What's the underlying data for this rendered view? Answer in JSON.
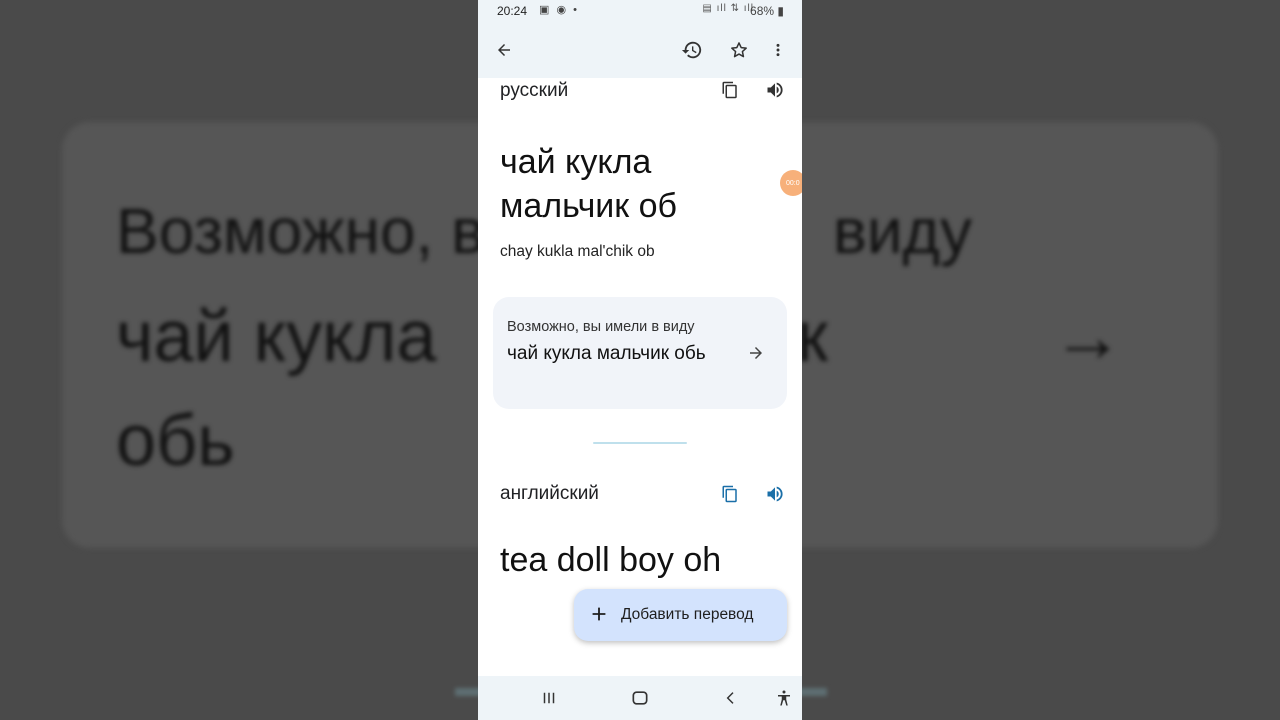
{
  "background": {
    "line1": "Возможно, в",
    "line1_right": "виду",
    "line2": "чай кукла",
    "line2_right": "к",
    "line3": "обь",
    "arrow": "→"
  },
  "status_bar": {
    "time": "20:24",
    "battery": "68%"
  },
  "top_bar": {
    "icons": [
      "back-arrow-icon",
      "history-icon",
      "star-icon",
      "more-vert-icon"
    ]
  },
  "source": {
    "language": "русский",
    "text": "чай кукла мальчик об",
    "transliteration": "chay kukla mal'chik ob"
  },
  "suggestion": {
    "label": "Возможно, вы имели в виду",
    "text": "чай кукла мальчик обь"
  },
  "target": {
    "language": "английский",
    "text": "tea doll boy oh"
  },
  "fab": {
    "label": "Добавить перевод"
  },
  "colors": {
    "accent": "#1a73e8",
    "card_bg": "#f1f4f9",
    "fab_bg": "#d3e3fd",
    "bar_bg": "#eef4f8"
  }
}
